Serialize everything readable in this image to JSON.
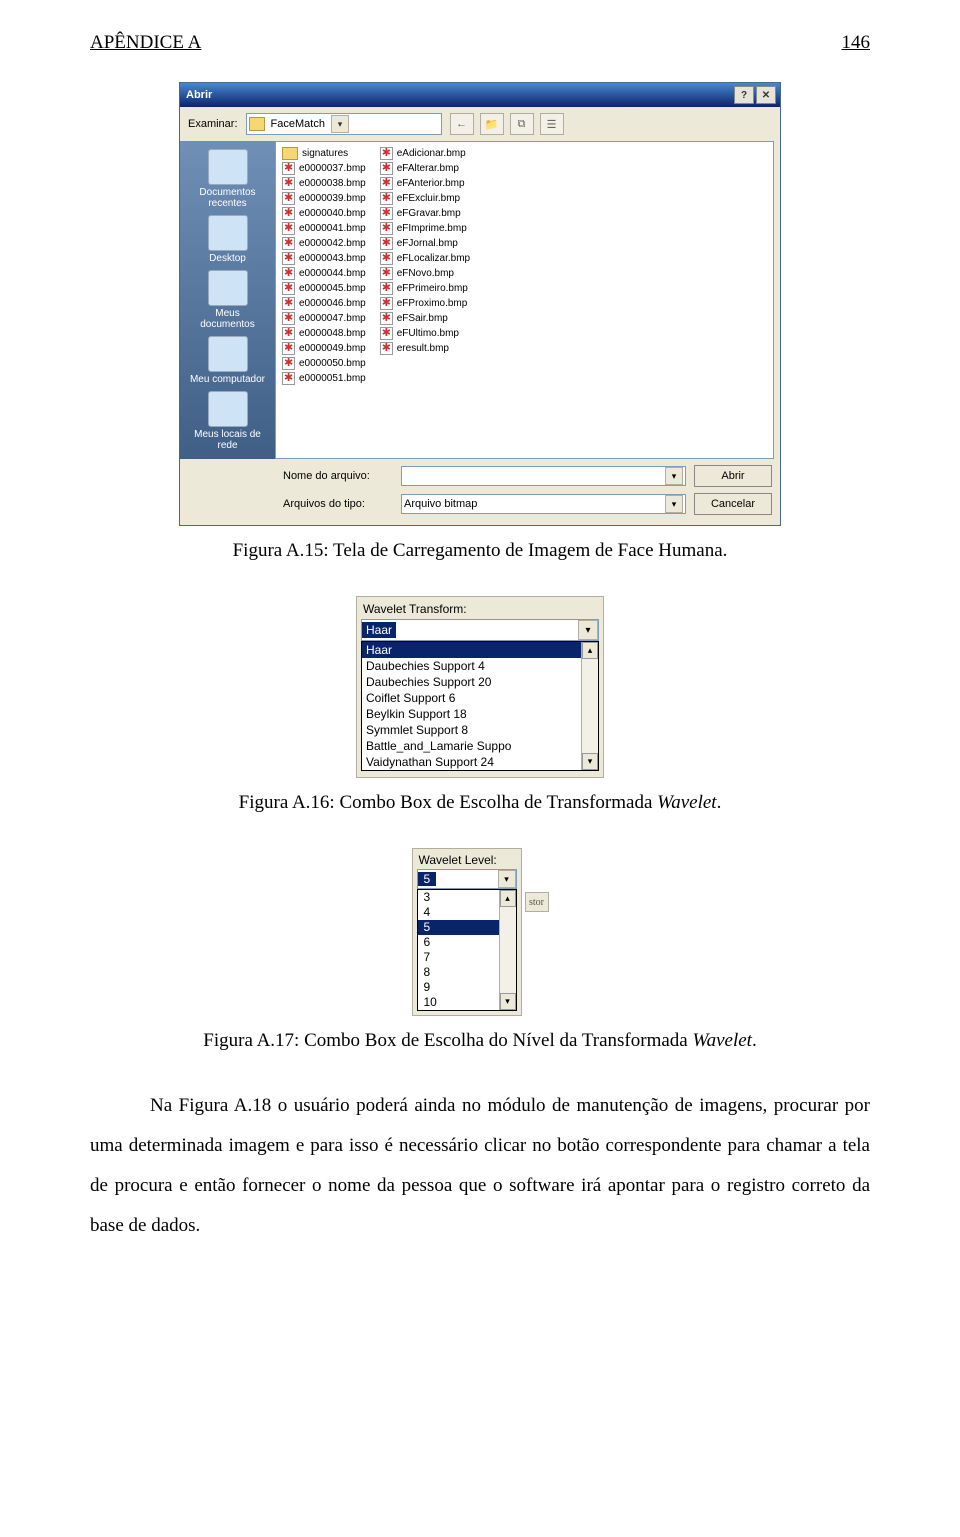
{
  "header": {
    "left": "APÊNDICE A",
    "right": "146"
  },
  "captions": {
    "fig15": "Figura A.15: Tela de Carregamento de Imagem de Face Humana.",
    "fig16_prefix": "Figura A.16: Combo Box de Escolha de Transformada ",
    "fig16_ital": "Wavelet",
    "fig16_suffix": ".",
    "fig17_prefix": "Figura A.17: Combo Box de Escolha do Nível da Transformada ",
    "fig17_ital": "Wavelet",
    "fig17_suffix": "."
  },
  "body": "Na Figura A.18 o usuário poderá ainda no módulo de manutenção de imagens, procurar por uma determinada imagem e para isso é necessário clicar no botão correspondente para chamar a tela de procura e então fornecer o nome da pessoa que o software irá apontar para o registro correto da base de dados.",
  "abrir": {
    "title": "Abrir",
    "examine_label": "Examinar:",
    "examine_value": "FaceMatch",
    "tool_icons": [
      "←",
      "📁",
      "⧉",
      "☰"
    ],
    "places": [
      "Documentos recentes",
      "Desktop",
      "Meus documentos",
      "Meu computador",
      "Meus locais de rede"
    ],
    "col1": [
      {
        "type": "folder",
        "name": "signatures"
      },
      {
        "type": "bmp",
        "name": "e0000037.bmp"
      },
      {
        "type": "bmp",
        "name": "e0000038.bmp"
      },
      {
        "type": "bmp",
        "name": "e0000039.bmp"
      },
      {
        "type": "bmp",
        "name": "e0000040.bmp"
      },
      {
        "type": "bmp",
        "name": "e0000041.bmp"
      },
      {
        "type": "bmp",
        "name": "e0000042.bmp"
      },
      {
        "type": "bmp",
        "name": "e0000043.bmp"
      },
      {
        "type": "bmp",
        "name": "e0000044.bmp"
      },
      {
        "type": "bmp",
        "name": "e0000045.bmp"
      },
      {
        "type": "bmp",
        "name": "e0000046.bmp"
      },
      {
        "type": "bmp",
        "name": "e0000047.bmp"
      },
      {
        "type": "bmp",
        "name": "e0000048.bmp"
      },
      {
        "type": "bmp",
        "name": "e0000049.bmp"
      },
      {
        "type": "bmp",
        "name": "e0000050.bmp"
      },
      {
        "type": "bmp",
        "name": "e0000051.bmp"
      }
    ],
    "col2": [
      {
        "type": "bmp",
        "name": "eAdicionar.bmp"
      },
      {
        "type": "bmp",
        "name": "eFAlterar.bmp"
      },
      {
        "type": "bmp",
        "name": "eFAnterior.bmp"
      },
      {
        "type": "bmp",
        "name": "eFExcluir.bmp"
      },
      {
        "type": "bmp",
        "name": "eFGravar.bmp"
      },
      {
        "type": "bmp",
        "name": "eFImprime.bmp"
      },
      {
        "type": "bmp",
        "name": "eFJornal.bmp"
      },
      {
        "type": "bmp",
        "name": "eFLocalizar.bmp"
      },
      {
        "type": "bmp",
        "name": "eFNovo.bmp"
      },
      {
        "type": "bmp",
        "name": "eFPrimeiro.bmp"
      },
      {
        "type": "bmp",
        "name": "eFProximo.bmp"
      },
      {
        "type": "bmp",
        "name": "eFSair.bmp"
      },
      {
        "type": "bmp",
        "name": "eFUltimo.bmp"
      },
      {
        "type": "bmp",
        "name": "eresult.bmp"
      }
    ],
    "filename_label": "Nome do arquivo:",
    "filename_value": "",
    "filetype_label": "Arquivos do tipo:",
    "filetype_value": "Arquivo bitmap",
    "open_btn": "Abrir",
    "cancel_btn": "Cancelar"
  },
  "wt": {
    "label": "Wavelet Transform:",
    "selected": "Haar",
    "options": [
      "Haar",
      "Daubechies Support 4",
      "Daubechies Support 20",
      "Coiflet Support 6",
      "Beylkin Support 18",
      "Symmlet Support 8",
      "Battle_and_Lamarie Suppo",
      "Vaidynathan Support 24"
    ]
  },
  "wl": {
    "label": "Wavelet Level:",
    "selected": "5",
    "options": [
      "3",
      "4",
      "5",
      "6",
      "7",
      "8",
      "9",
      "10"
    ],
    "sidefrag": "stor"
  }
}
